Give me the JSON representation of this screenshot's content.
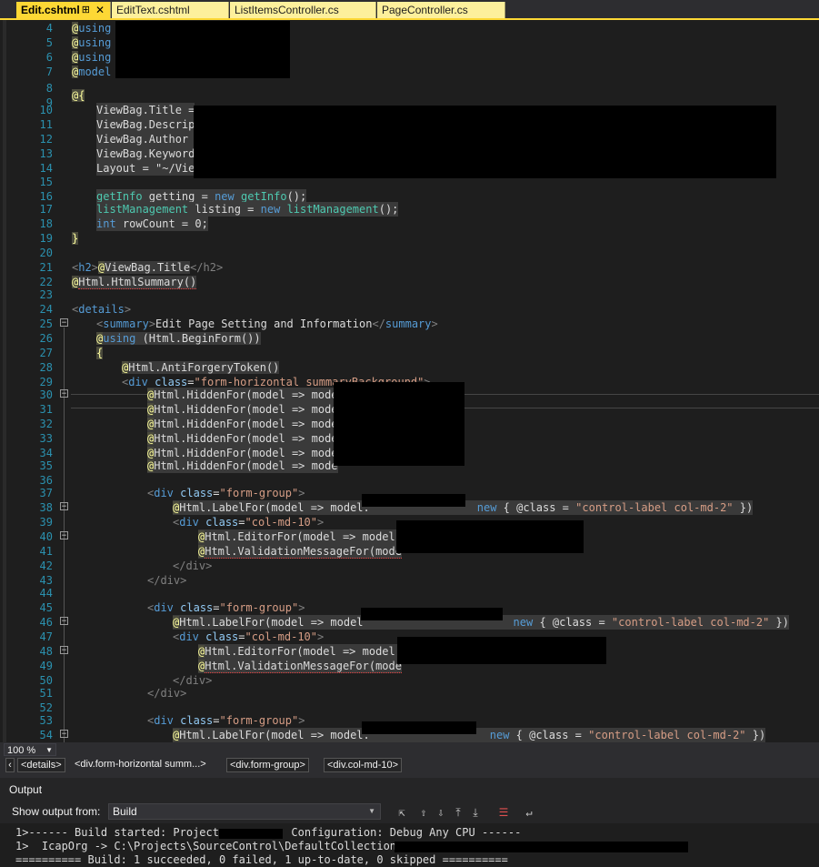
{
  "tabs": [
    {
      "label": "Edit.cshtml",
      "active": true,
      "pin": "⊞",
      "close": "✕"
    },
    {
      "label": "EditText.cshtml",
      "active": false
    },
    {
      "label": "ListItemsController.cs",
      "active": false
    },
    {
      "label": "PageController.cs",
      "active": false
    }
  ],
  "editor": {
    "line_numbers": [
      "4",
      "5",
      "6",
      "7",
      "8",
      "9",
      "10",
      "11",
      "12",
      "13",
      "14",
      "15",
      "16",
      "17",
      "18",
      "19",
      "20",
      "21",
      "22",
      "23",
      "24",
      "25",
      "26",
      "27",
      "28",
      "29",
      "30",
      "31",
      "32",
      "33",
      "34",
      "35",
      "36",
      "37",
      "38",
      "39",
      "40",
      "41",
      "42",
      "43",
      "44",
      "45",
      "46",
      "47",
      "48",
      "49",
      "50",
      "51",
      "52",
      "53",
      "54"
    ],
    "lines": {
      "l4": "using ",
      "l5": "using ",
      "l6": "using ",
      "l7": "model ",
      "l9": "{",
      "l10": "ViewBag.Title =",
      "l11": "ViewBag.Descript",
      "l12": "ViewBag.Author =",
      "l13": "ViewBag.Keywords",
      "l14": "Layout = \"~/View",
      "l16_type": "getInfo",
      "l16_rest": " getting = ",
      "l16_new": "new",
      "l16_ctor": "getInfo",
      "l16_end": "();",
      "l17_type": "listManagement",
      "l17_rest": " listing = ",
      "l17_new": "new",
      "l17_ctor": "listManagement",
      "l17_end": "();",
      "l18_kw": "int",
      "l18_rest": " rowCount = 0;",
      "l19": "}",
      "l21_open": "<",
      "l21_tag": "h2",
      "l21_close": ">",
      "l21_razor": "ViewBag.Title",
      "l21_end": "</h2>",
      "l22": "Html.HtmlSummary()",
      "l24_tag": "details",
      "l25_tag": "summary",
      "l25_text": "Edit Page Setting and Information",
      "l25_end": "summary",
      "l26_kw": "using",
      "l26_rest": " (Html.BeginForm())",
      "l27": "{",
      "l28": "Html.AntiForgeryToken()",
      "l29_tag": "div",
      "l29_attr": "class",
      "l29_val": "\"form-horizontal summaryBackground\"",
      "hidden_for": "Html.HiddenFor(model => mode",
      "l37_val": "\"form-group\"",
      "l38_pre": "Html.LabelFor(model => model.",
      "l38_new": "new",
      "l38_mid": " { @class = ",
      "l38_str": "\"control-label col-md-2\"",
      "l38_end": " })",
      "l39_val": "\"col-md-10\"",
      "l40": "Html.EditorFor(model => model.",
      "l41": "Html.ValidationMessageFor(mode",
      "l42_end": "</div>",
      "l46_pre": "Html.LabelFor(model => model",
      "l48": "Html.EditorFor(model => model.F",
      "l49": "Html.ValidationMessageFor(mode",
      "l54_pre": "Html.LabelFor(model => model."
    }
  },
  "status": {
    "zoom": "100 %"
  },
  "breadcrumbs": [
    "<details>",
    "<div.form-horizontal summ...>",
    "<div.form-group>",
    "<div.col-md-10>"
  ],
  "output": {
    "title": "Output",
    "show_from_label": "Show output from:",
    "source": "Build",
    "lines": [
      "1>------ Build started: Project:          Configuration: Debug Any CPU ------",
      "1>  IcapOrg -> C:\\Projects\\SourceControl\\DefaultCollection\\",
      "========== Build: 1 succeeded, 0 failed, 1 up-to-date, 0 skipped =========="
    ]
  }
}
